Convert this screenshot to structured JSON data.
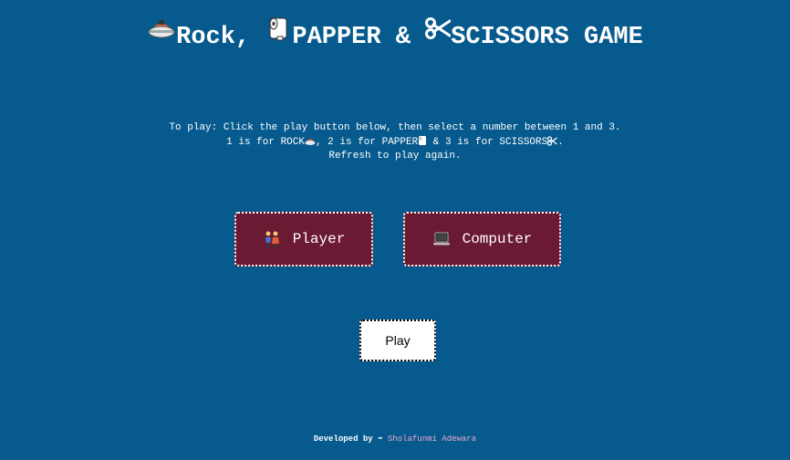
{
  "header": {
    "part1": "Rock, ",
    "part2": "PAPPER & ",
    "part3": "SCISSORS GAME",
    "icons": [
      "rock-icon",
      "toilet-paper-icon",
      "scissors-icon"
    ]
  },
  "instructions": {
    "line1": "To play: Click the play button below, then select a number between 1 and 3.",
    "line2a": "1 is for ROCK",
    "line2b": ", 2 is for PAPPER",
    "line2c": " & 3 is for SCISSORS",
    "line2d": ".",
    "line3": "Refresh to play again."
  },
  "cards": {
    "player_label": "Player",
    "computer_label": "Computer"
  },
  "play": {
    "label": "Play"
  },
  "footer": {
    "developed_by": "Developed by",
    "arrow": "➡",
    "author": "Sholafunmi Adewara"
  },
  "colors": {
    "background": "#065a8e",
    "card": "#6b1a33",
    "link": "#f3a8cc"
  }
}
